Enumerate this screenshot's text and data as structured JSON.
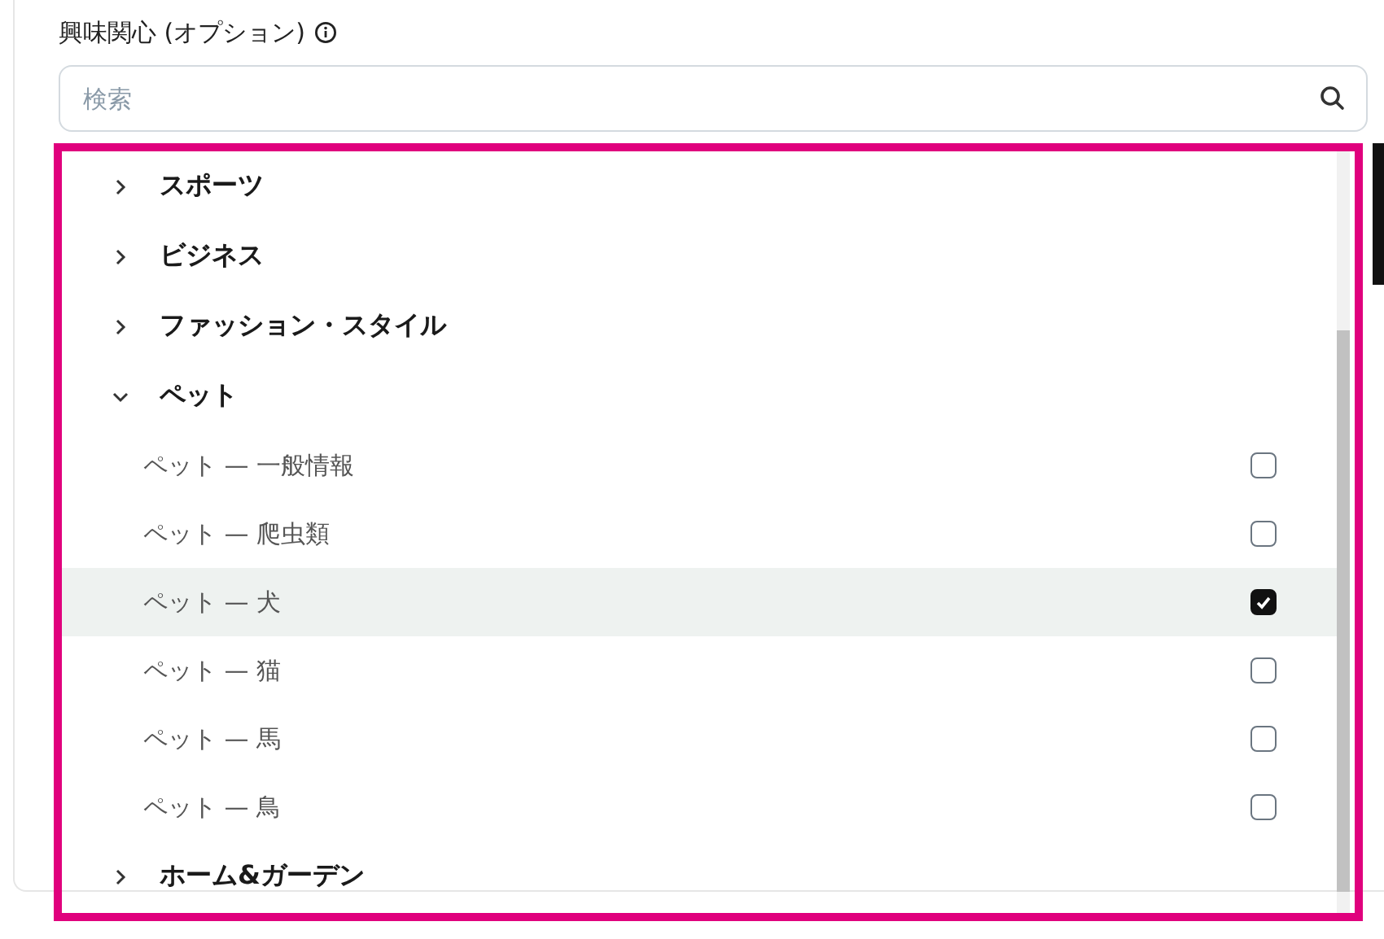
{
  "field_label": "興味関心 (オプション)",
  "search": {
    "placeholder": "検索"
  },
  "categories": [
    {
      "label": "スポーツ",
      "expanded": false
    },
    {
      "label": "ビジネス",
      "expanded": false
    },
    {
      "label": "ファッション・スタイル",
      "expanded": false
    },
    {
      "label": "ペット",
      "expanded": true,
      "children": [
        {
          "label": "ペット — 一般情報",
          "checked": false,
          "selected": false
        },
        {
          "label": "ペット — 爬虫類",
          "checked": false,
          "selected": false
        },
        {
          "label": "ペット — 犬",
          "checked": true,
          "selected": true
        },
        {
          "label": "ペット — 猫",
          "checked": false,
          "selected": false
        },
        {
          "label": "ペット — 馬",
          "checked": false,
          "selected": false
        },
        {
          "label": "ペット — 鳥",
          "checked": false,
          "selected": false
        }
      ]
    },
    {
      "label": "ホーム&ガーデン",
      "expanded": false
    }
  ]
}
